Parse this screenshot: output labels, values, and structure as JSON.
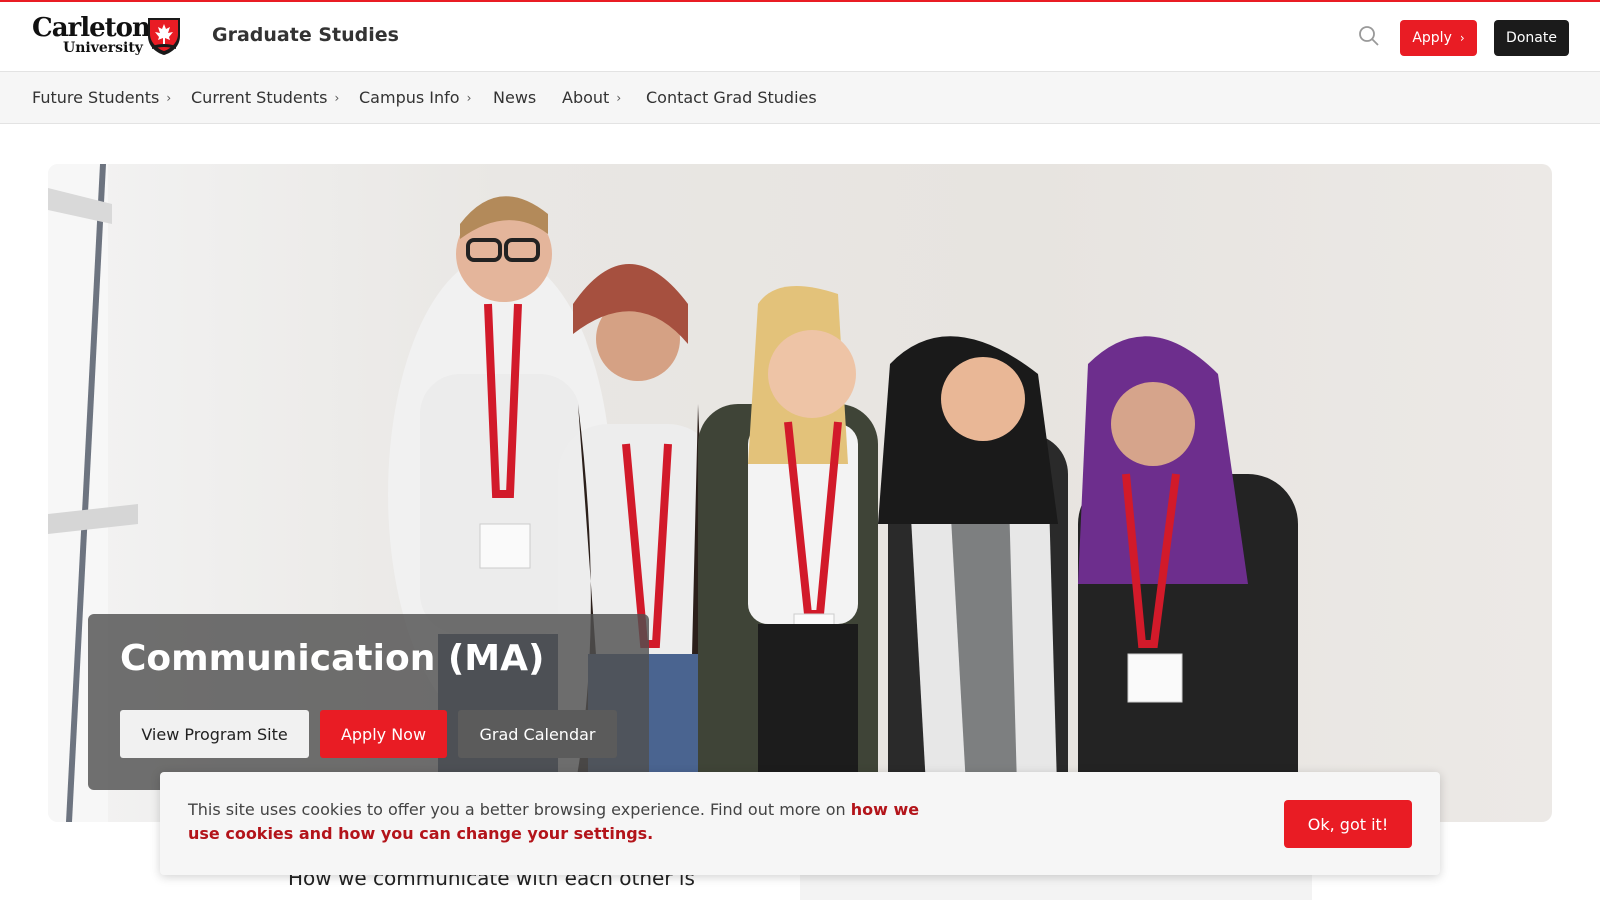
{
  "header": {
    "logo_line1": "Carleton",
    "logo_line2": "University",
    "site_title": "Graduate Studies",
    "search_icon": "search-icon",
    "apply_label": "Apply",
    "donate_label": "Donate",
    "brand_color": "#e91c24"
  },
  "nav": {
    "items": [
      {
        "label": "Future Students",
        "has_submenu": true
      },
      {
        "label": "Current Students",
        "has_submenu": true
      },
      {
        "label": "Campus Info",
        "has_submenu": true
      },
      {
        "label": "News",
        "has_submenu": false
      },
      {
        "label": "About",
        "has_submenu": true
      },
      {
        "label": "Contact Grad Studies",
        "has_submenu": false
      }
    ]
  },
  "hero": {
    "title": "Communication (MA)",
    "buttons": {
      "view_program": "View Program Site",
      "apply_now": "Apply Now",
      "grad_calendar": "Grad Calendar"
    }
  },
  "content": {
    "intro_text": "How we communicate with each other is"
  },
  "cookie_banner": {
    "text": "This site uses cookies to offer you a better browsing experience. Find out more on ",
    "link_text": "how we use cookies and how you can change your settings.",
    "button_label": "Ok, got it!"
  }
}
